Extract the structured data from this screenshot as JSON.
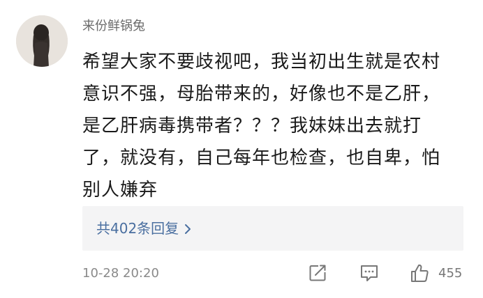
{
  "comment": {
    "username": "来份鲜锅兔",
    "lines": [
      "希望大家不要歧视吧，我当初出生就是农村",
      "意识不强，母胎带来的，好像也不是乙肝，",
      "是乙肝病毒携带者？？？我妹妹出去就打",
      "了，就没有，自己每年也检查，也自卑，怕",
      "别人嫌弃"
    ],
    "replies_label": "共402条回复",
    "timestamp": "10-28 20:20",
    "like_count": "455"
  },
  "icons": {
    "share": "share-icon",
    "reply": "comment-icon",
    "like": "thumbs-up-icon",
    "chevron": "chevron-right-icon"
  },
  "colors": {
    "link": "#4a6fa0",
    "reply_bg": "#f4f4f5",
    "text": "#1a1a1a",
    "muted": "#8a8a8a",
    "icon": "#777777"
  }
}
